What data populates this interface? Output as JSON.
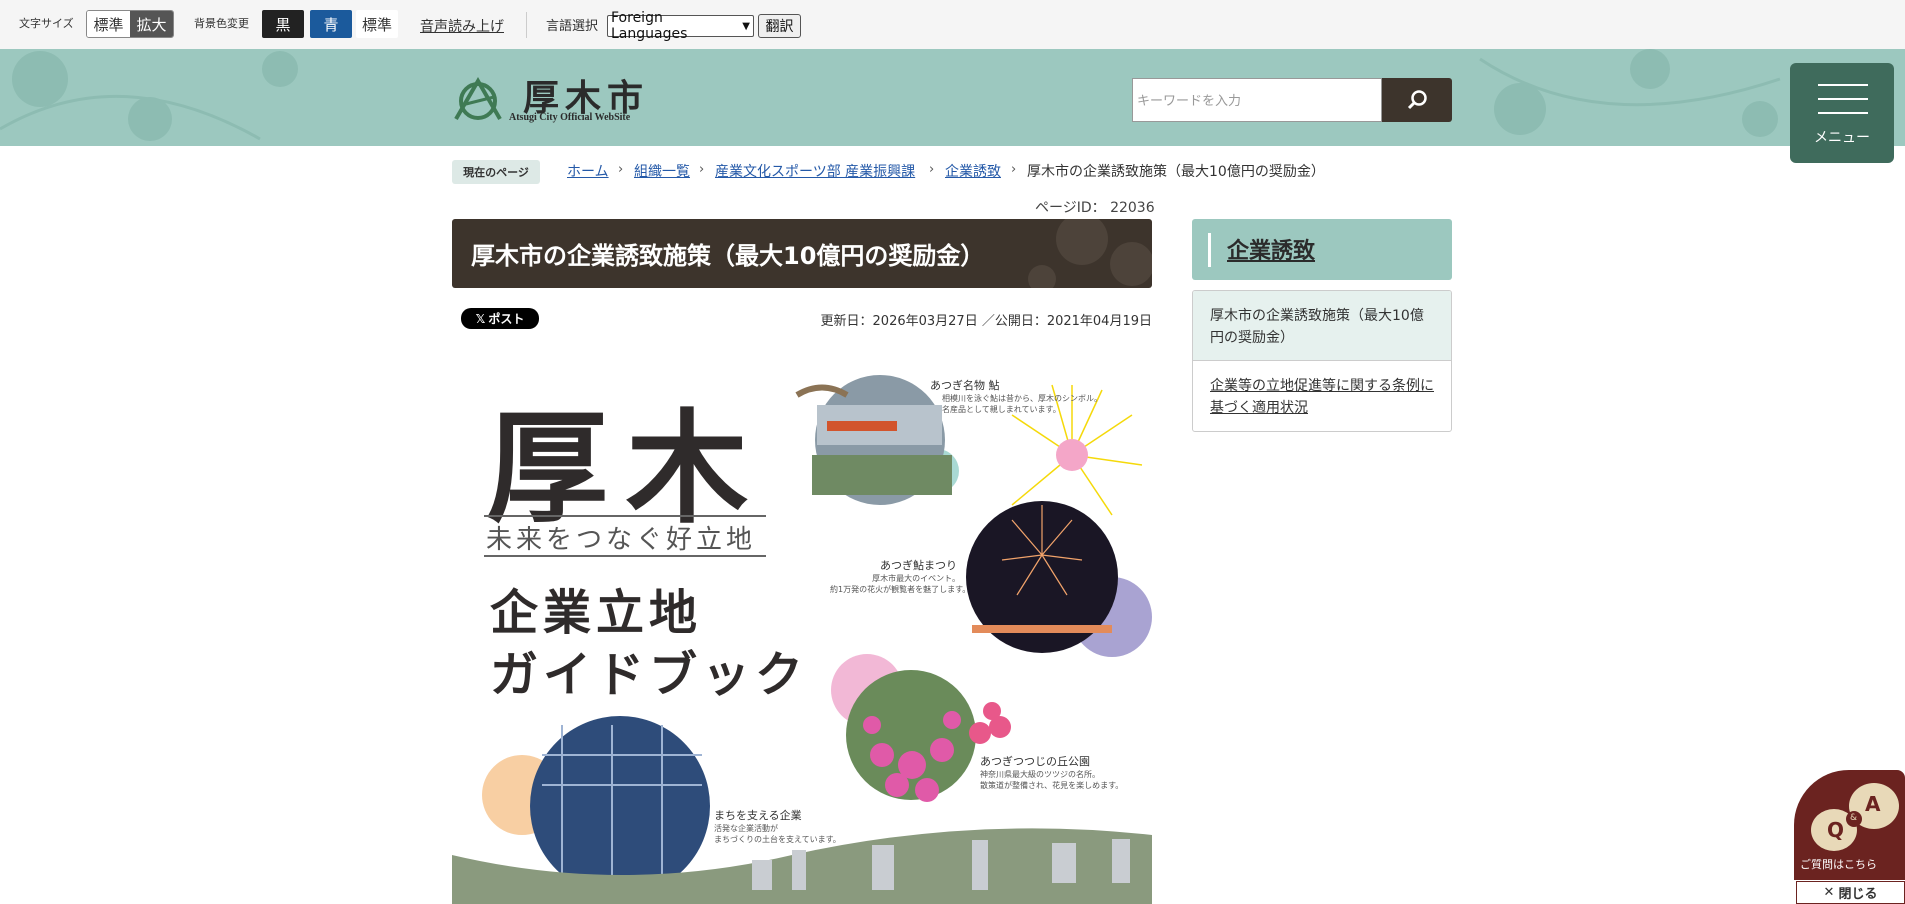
{
  "toolbar": {
    "font_size_label": "文字サイズ",
    "font_standard": "標準",
    "font_large": "拡大",
    "bg_color_label": "背景色変更",
    "bg_black": "黒",
    "bg_blue": "青",
    "bg_standard": "標準",
    "read_aloud": "音声読み上げ",
    "language_label": "言語選択",
    "language_selected": "Foreign Languages",
    "translate_button": "翻訳"
  },
  "header": {
    "logo_title": "厚木市",
    "logo_subtitle": "Atsugi City Official WebSite",
    "search_placeholder": "キーワードを入力",
    "menu_label": "メニュー"
  },
  "breadcrumb": {
    "current_label": "現在のページ",
    "items": [
      "ホーム",
      "組織一覧",
      "産業文化スポーツ部 産業振興課",
      "企業誘致"
    ],
    "current": "厚木市の企業誘致施策（最大10億円の奨励金）"
  },
  "page": {
    "page_id": "ページID： 22036",
    "title": "厚木市の企業誘致施策（最大10億円の奨励金）",
    "x_post": "ポスト",
    "dates": "更新日：2026年03月27日 ／公開日：2021年04月19日"
  },
  "hero": {
    "big_title": "厚木",
    "tagline": "未来をつなぐ好立地",
    "line1": "企業立地",
    "line2": "ガイドブック",
    "cap_ayu": "あつぎ名物 鮎",
    "cap_ayu_sub": "相模川を泳ぐ鮎は昔から、厚木のシンボル。\n名産品として親しまれています。",
    "cap_fest": "あつぎ鮎まつり",
    "cap_fest_sub": "厚木市最大のイベント。\n約1万発の花火が観覧者を魅了します。",
    "cap_park": "あつぎつつじの丘公園",
    "cap_park_sub": "神奈川県最大級のツツジの名所。\n散策道が整備され、花見を楽しめます。",
    "cap_ind": "まちを支える企業",
    "cap_ind_sub": "活発な企業活動が\nまちづくりの土台を支えています。"
  },
  "sidebar": {
    "heading": "企業誘致",
    "items": [
      "厚木市の企業誘致施策（最大10億円の奨励金）",
      "企業等の立地促進等に関する条例に基づく適用状況"
    ]
  },
  "qa": {
    "q": "Q",
    "and": "&",
    "a": "A",
    "label": "ご質問はこちら",
    "close": "閉じる"
  },
  "colors": {
    "header_bg": "#9cc8bf",
    "title_bg": "#3d342c",
    "menu_bg": "#3f6b5c",
    "blue_btn": "#1b5a9c",
    "qa_bg": "#6b2320"
  }
}
